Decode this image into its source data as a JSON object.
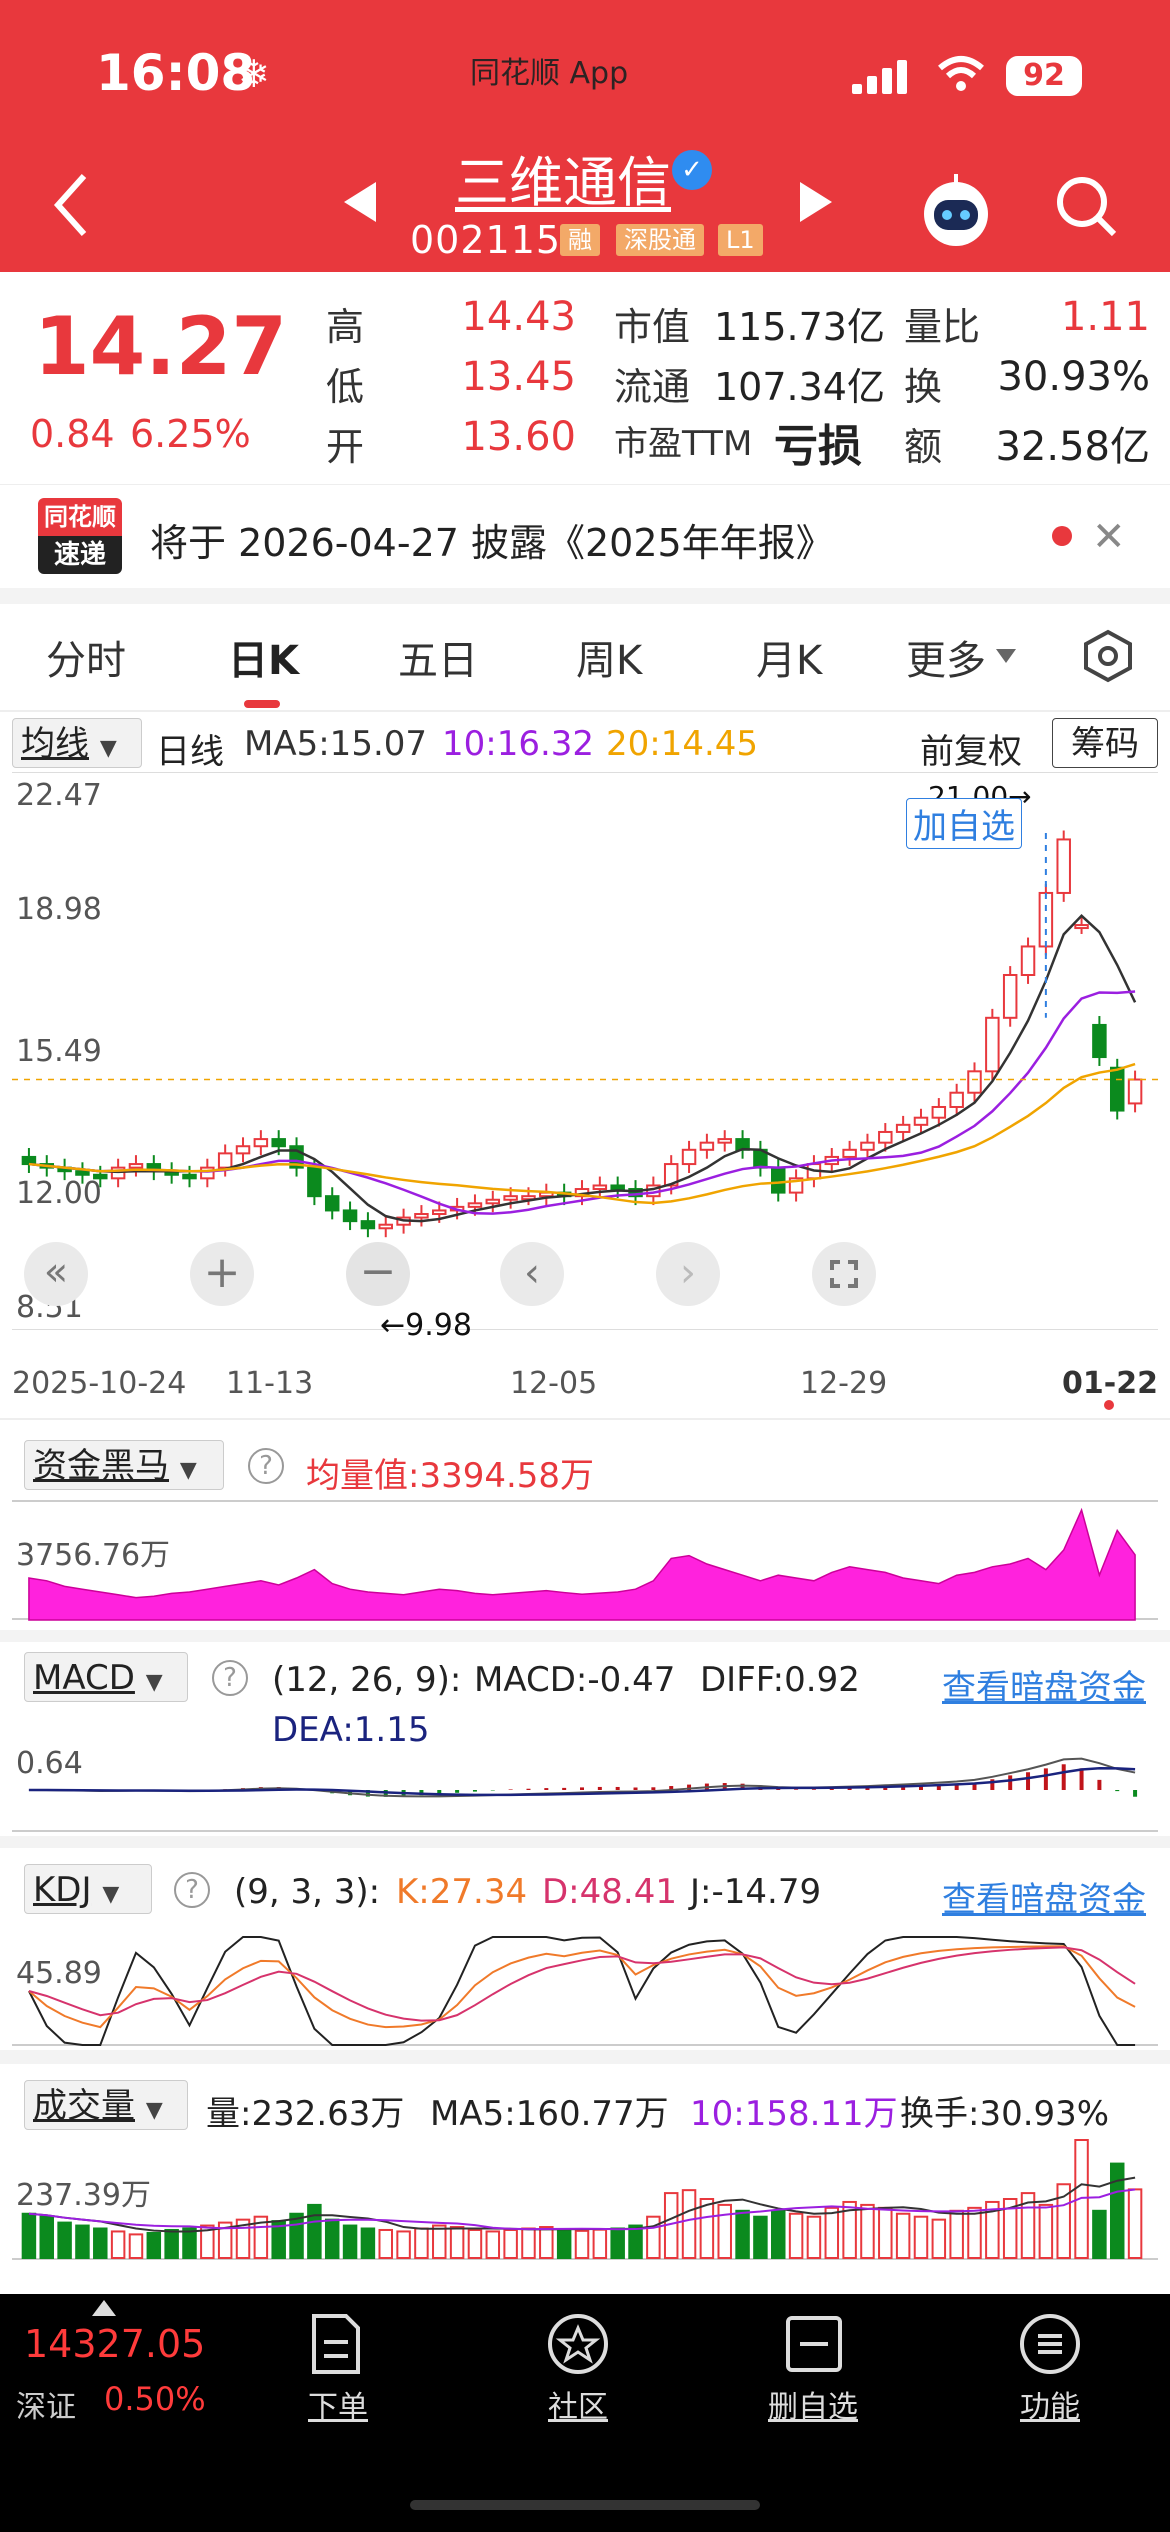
{
  "status_bar": {
    "time": "16:08",
    "app": "同花顺 App",
    "battery": "92"
  },
  "header": {
    "stock_name": "三维通信",
    "stock_code": "002115",
    "tags": [
      "融",
      "深股通",
      "L1"
    ]
  },
  "quote": {
    "price": "14.27",
    "change": "0.84",
    "change_pct": "6.25%",
    "rows": [
      {
        "l1": "高",
        "v1": "14.43",
        "l2": "市值",
        "v2": "115.73亿",
        "l3": "量比",
        "v3": "1.11"
      },
      {
        "l1": "低",
        "v1": "13.45",
        "l2": "流通",
        "v2": "107.34亿",
        "l3": "换",
        "v3": "30.93%"
      },
      {
        "l1": "开",
        "v1": "13.60",
        "l2": "市盈TTM",
        "v2": "亏损",
        "l3": "额",
        "v3": "32.58亿"
      }
    ]
  },
  "news": {
    "logo_line1": "同花顺",
    "logo_line2": "速递",
    "text": "将于 2026-04-27 披露《2025年年报》"
  },
  "tabs": [
    "分时",
    "日K",
    "五日",
    "周K",
    "月K",
    "更多"
  ],
  "kchart": {
    "ma_select": "均线",
    "period": "日线",
    "ma5": "MA5:15.07",
    "ma10": "10:16.32",
    "ma20": "20:14.45",
    "adjust": "前复权",
    "chips": "筹码",
    "y_ticks": [
      "22.47",
      "18.98",
      "15.49",
      "12.00",
      "8.51"
    ],
    "high_note": "21.00→",
    "low_note": "←9.98",
    "add_watch": "加自选",
    "x_ticks": [
      "2025-10-24",
      "11-13",
      "12-05",
      "12-29",
      "01-22"
    ],
    "colors": {
      "up": "#e8383d",
      "down": "#0b8a1e",
      "ma5": "#333333",
      "ma10": "#9b1fe0",
      "ma20": "#f0a400"
    }
  },
  "chart_data": {
    "type": "candlestick",
    "open": [
      12.1,
      11.9,
      11.8,
      11.7,
      11.6,
      11.5,
      11.8,
      11.9,
      11.7,
      11.6,
      11.5,
      11.8,
      12.2,
      12.4,
      12.6,
      12.4,
      11.8,
      11.0,
      10.6,
      10.3,
      10.1,
      10.2,
      10.4,
      10.5,
      10.6,
      10.7,
      10.8,
      10.9,
      11.0,
      11.0,
      11.1,
      11.0,
      11.2,
      11.3,
      11.2,
      11.0,
      11.3,
      11.9,
      12.3,
      12.5,
      12.6,
      12.3,
      11.8,
      11.1,
      11.5,
      11.9,
      12.1,
      12.3,
      12.5,
      12.8,
      13.0,
      13.2,
      13.5,
      13.9,
      14.5,
      16.0,
      17.2,
      18.0,
      19.5,
      18.6,
      15.8,
      14.6,
      13.6
    ],
    "close": [
      11.9,
      11.8,
      11.7,
      11.6,
      11.5,
      11.8,
      11.9,
      11.7,
      11.6,
      11.5,
      11.8,
      12.2,
      12.4,
      12.6,
      12.4,
      11.8,
      11.0,
      10.6,
      10.3,
      10.1,
      10.2,
      10.4,
      10.5,
      10.6,
      10.7,
      10.8,
      10.9,
      11.0,
      11.0,
      11.1,
      11.0,
      11.2,
      11.3,
      11.2,
      11.0,
      11.3,
      11.9,
      12.3,
      12.5,
      12.6,
      12.3,
      11.8,
      11.1,
      11.5,
      11.9,
      12.1,
      12.3,
      12.5,
      12.8,
      13.0,
      13.2,
      13.5,
      13.9,
      14.5,
      16.0,
      17.2,
      18.0,
      19.5,
      21.0,
      18.6,
      14.9,
      13.4,
      14.27
    ],
    "volume": [
      150,
      140,
      120,
      110,
      100,
      90,
      80,
      85,
      95,
      100,
      110,
      120,
      130,
      140,
      125,
      150,
      180,
      130,
      110,
      100,
      95,
      90,
      100,
      110,
      105,
      95,
      90,
      95,
      100,
      105,
      98,
      92,
      96,
      100,
      110,
      140,
      220,
      230,
      200,
      180,
      160,
      140,
      160,
      150,
      140,
      170,
      190,
      180,
      170,
      150,
      140,
      130,
      160,
      170,
      190,
      200,
      220,
      180,
      250,
      400,
      160,
      320,
      232.63
    ],
    "ma5_value": "15.07",
    "ma10_value": "16.32",
    "ma20_value": "14.45",
    "ylim": [
      8.51,
      22.47
    ]
  },
  "fund_panel": {
    "select": "资金黑马",
    "label": "均量值:3394.58万",
    "axis": "3756.76万"
  },
  "macd_panel": {
    "select": "MACD",
    "params": "(12, 26, 9):",
    "macd": "MACD:-0.47",
    "diff": "DIFF:0.92",
    "dea": "DEA:1.15",
    "axis": "0.64",
    "link": "查看暗盘资金"
  },
  "kdj_panel": {
    "select": "KDJ",
    "params": "(9, 3, 3):",
    "k": "K:27.34",
    "d": "D:48.41",
    "j": "J:-14.79",
    "axis": "45.89",
    "link": "查看暗盘资金"
  },
  "vol_panel": {
    "select": "成交量",
    "vol": "量:232.63万",
    "ma5": "MA5:160.77万",
    "ma10": "10:158.11万",
    "turnover": "换手:30.93%",
    "axis": "237.39万"
  },
  "bottom_nav": {
    "index_value": "14327.05",
    "index_name": "深证",
    "index_pct": "0.50%",
    "items": [
      "下单",
      "社区",
      "删自选",
      "功能"
    ]
  }
}
